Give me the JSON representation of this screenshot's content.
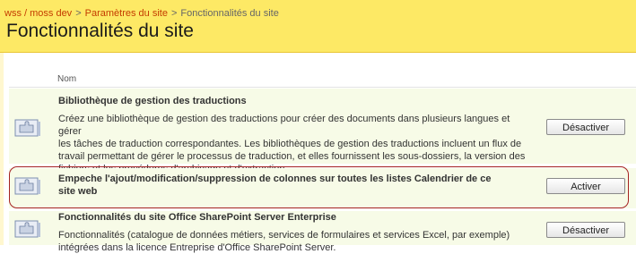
{
  "breadcrumb": {
    "site": "wss / moss dev",
    "sep1": ">",
    "settings": "Paramètres du site",
    "sep2": ">",
    "current": "Fonctionnalités du site"
  },
  "page_title": "Fonctionnalités du site",
  "table": {
    "column_name": "Nom",
    "features": [
      {
        "title": "Bibliothèque de gestion des traductions",
        "description_lines": [
          "Créez une bibliothèque de gestion des traductions pour créer des documents dans plusieurs langues et gérer",
          "les tâches de traduction correspondantes. Les bibliothèques de gestion des traductions incluent un flux de",
          "travail permettant de gérer le processus de traduction, et elles fournissent les sous-dossiers, la version des",
          "fichiers et les procédures d'archivage et d'extraction."
        ],
        "button": "Désactiver",
        "icon": "puzzle-feature-icon"
      },
      {
        "title_lines": [
          "Empeche l'ajout/modification/suppression de colonnes sur toutes les listes Calendrier de ce",
          "site web"
        ],
        "button": "Activer",
        "icon": "puzzle-feature-icon",
        "highlighted": true
      },
      {
        "title": "Fonctionnalités du site Office SharePoint Server Enterprise",
        "description_lines": [
          "Fonctionnalités (catalogue de données métiers, services de formulaires et services Excel, par exemple)",
          "intégrées dans la licence Entreprise d'Office SharePoint Server."
        ],
        "button": "Désactiver",
        "icon": "puzzle-feature-icon"
      }
    ]
  },
  "colors": {
    "header_bg": "#fde965",
    "breadcrumb_link": "#c43c00",
    "row_bg": "#f7fbe7",
    "highlight": "#a52222"
  }
}
